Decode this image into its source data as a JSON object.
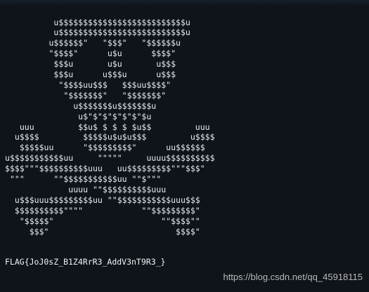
{
  "terminal": {
    "top_hint": "",
    "ascii_art": "          u$$$$$$$$$$$$$$$$$$$$$$$$$$u\n          u$$$$$$$$$$$$$$$$$$$$$$$$$$u\n         u$$$$$$\"   \"$$$\"   \"$$$$$$u\n         \"$$$$\"      u$u      $$$$\"\n          $$$u       u$u       u$$$\n          $$$u      u$$$u      u$$$\n           \"$$$$uu$$$   $$$uu$$$$\"\n            \"$$$$$$$\"   \"$$$$$$$\"\n              u$$$$$$$u$$$$$$$u\n               u$\"$\"$\"$\"$\"$\"$u\n   uuu         $$u$ $ $ $ $u$$         uuu\n  u$$$$         $$$$$u$u$u$$$         u$$$$\n   $$$$$uu      \"$$$$$$$$$\"      uu$$$$$$\nu$$$$$$$$$$$uu     \"\"\"\"\"     uuuu$$$$$$$$$$\n$$$$\"\"\"$$$$$$$$$$uuu   uu$$$$$$$$$\"\"\"$$$\"\n \"\"\"      \"\"$$$$$$$$$$$uu \"\"$\"\"\"\n             uuuu \"\"$$$$$$$$$$uuu\n  u$$$uuu$$$$$$$$$uu \"\"$$$$$$$$$$$uuu$$$\n  $$$$$$$$$$\"\"\"\"            \"\"$$$$$$$$$\"\n   \"$$$$$\"                      \"\"$$$$\"\"\n     $$$\"                          $$$$\"",
    "flag": "FLAG{JoJ0sZ_B1Z4RrR3_AddV3nT9R3_}"
  },
  "watermark": {
    "text": "https://blog.csdn.net/qq_45918115"
  },
  "colors": {
    "background": "#0f141a",
    "terminal_text": "#e6edf3",
    "watermark": "#ffffff"
  }
}
